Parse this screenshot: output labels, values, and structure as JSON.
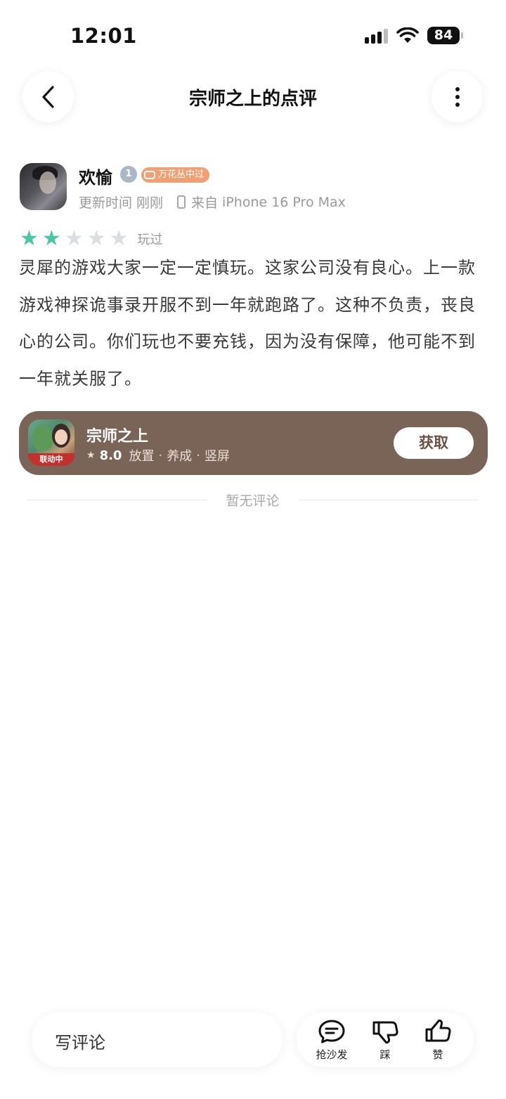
{
  "status_bar": {
    "time": "12:01",
    "battery": "84",
    "icons": [
      "signal-icon",
      "wifi-icon",
      "battery-icon"
    ]
  },
  "nav": {
    "title": "宗师之上的点评",
    "back_icon": "chevron-left-icon",
    "more_icon": "more-vertical-icon"
  },
  "review": {
    "user": {
      "name": "欢愉",
      "level": "1",
      "tag": "万花丛中过",
      "update_label": "更新时间",
      "update_time": "刚刚",
      "device_prefix": "来自",
      "device": "iPhone 16 Pro Max"
    },
    "rating": {
      "value": 2,
      "max": 5,
      "played_label": "玩过"
    },
    "text": "灵犀的游戏大家一定一定慎玩。这家公司没有良心。上一款游戏神探诡事录开服不到一年就跑路了。这种不负责，丧良心的公司。你们玩也不要充钱，因为没有保障，他可能不到一年就关服了。"
  },
  "game_card": {
    "name": "宗师之上",
    "score": "8.0",
    "tags": [
      "放置",
      "养成",
      "竖屏"
    ],
    "badge": "联动中",
    "button": "获取",
    "background": "#7a6458"
  },
  "comments": {
    "empty_text": "暂无评论"
  },
  "bottom_bar": {
    "input_placeholder": "写评论",
    "actions": [
      {
        "label": "抢沙发",
        "icon": "comment-bubble-icon"
      },
      {
        "label": "踩",
        "icon": "thumbs-down-icon"
      },
      {
        "label": "赞",
        "icon": "thumbs-up-icon"
      }
    ]
  },
  "colors": {
    "star_on": "#4cc5a8",
    "star_off": "#dadde2",
    "tag_badge": "#f0a072"
  }
}
